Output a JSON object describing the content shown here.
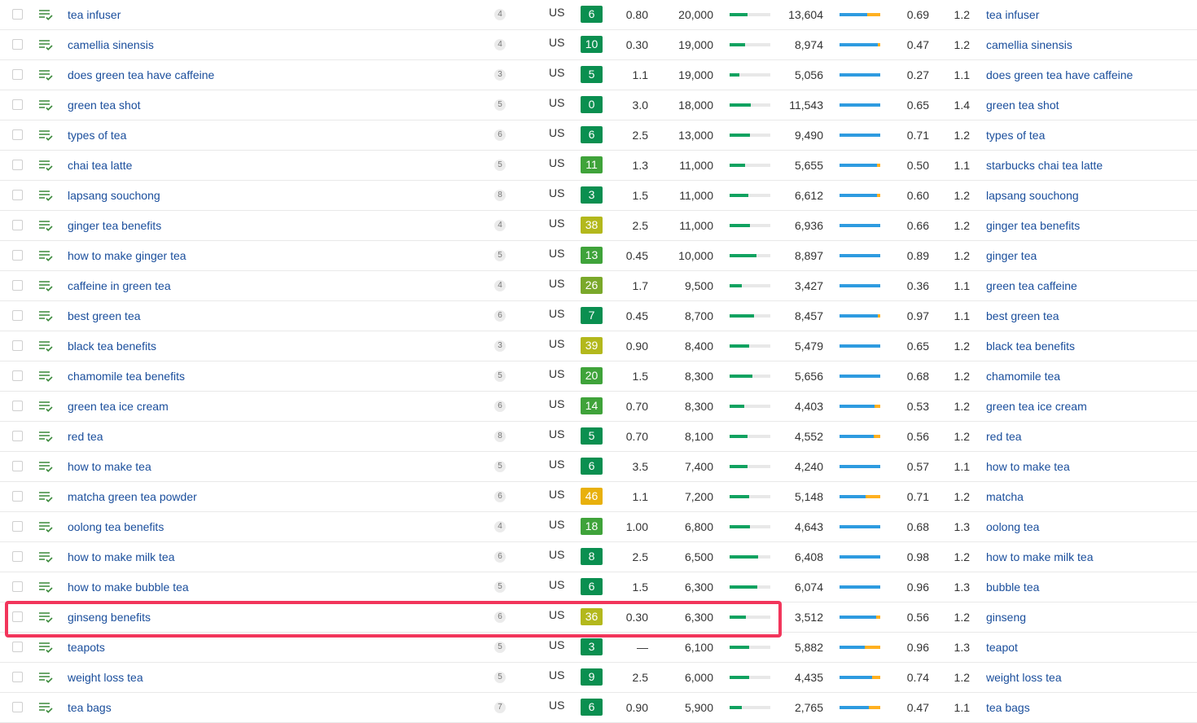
{
  "colors": {
    "link": "#1a4e9c",
    "highlight_border": "#f2355b",
    "kd_dark_green": "#0a8f50",
    "kd_green": "#3fa33a",
    "kd_lime": "#b3b81c",
    "kd_yellow": "#e8b00c",
    "volume_bar": "#10a260",
    "clicks_bar_blue": "#2e9be0",
    "clicks_bar_orange": "#ffb020"
  },
  "icons": {
    "row_icon": "list-check-icon"
  },
  "highlighted_keyword": "ginseng benefits",
  "rows": [
    {
      "keyword": "tea infuser",
      "position": "4",
      "country": "US",
      "kd": "6",
      "kd_color": "#0a8f50",
      "cpc": "0.80",
      "volume": "20,000",
      "volume_fill": 0.44,
      "clicks": "13,604",
      "clicks_fill": 0.68,
      "ratio": "0.69",
      "rr": "1.2",
      "parent": "tea infuser"
    },
    {
      "keyword": "camellia sinensis",
      "position": "4",
      "country": "US",
      "kd": "10",
      "kd_color": "#0a8f50",
      "cpc": "0.30",
      "volume": "19,000",
      "volume_fill": 0.38,
      "clicks": "8,974",
      "clicks_fill": 0.94,
      "ratio": "0.47",
      "rr": "1.2",
      "parent": "camellia sinensis"
    },
    {
      "keyword": "does green tea have caffeine",
      "position": "3",
      "country": "US",
      "kd": "5",
      "kd_color": "#0a8f50",
      "cpc": "1.1",
      "volume": "19,000",
      "volume_fill": 0.24,
      "clicks": "5,056",
      "clicks_fill": 1.0,
      "ratio": "0.27",
      "rr": "1.1",
      "parent": "does green tea have caffeine"
    },
    {
      "keyword": "green tea shot",
      "position": "5",
      "country": "US",
      "kd": "0",
      "kd_color": "#0a8f50",
      "cpc": "3.0",
      "volume": "18,000",
      "volume_fill": 0.52,
      "clicks": "11,543",
      "clicks_fill": 1.0,
      "ratio": "0.65",
      "rr": "1.4",
      "parent": "green tea shot"
    },
    {
      "keyword": "types of tea",
      "position": "6",
      "country": "US",
      "kd": "6",
      "kd_color": "#0a8f50",
      "cpc": "2.5",
      "volume": "13,000",
      "volume_fill": 0.5,
      "clicks": "9,490",
      "clicks_fill": 1.0,
      "ratio": "0.71",
      "rr": "1.2",
      "parent": "types of tea"
    },
    {
      "keyword": "chai tea latte",
      "position": "5",
      "country": "US",
      "kd": "11",
      "kd_color": "#3fa33a",
      "cpc": "1.3",
      "volume": "11,000",
      "volume_fill": 0.38,
      "clicks": "5,655",
      "clicks_fill": 0.92,
      "ratio": "0.50",
      "rr": "1.1",
      "parent": "starbucks chai tea latte"
    },
    {
      "keyword": "lapsang souchong",
      "position": "8",
      "country": "US",
      "kd": "3",
      "kd_color": "#0a8f50",
      "cpc": "1.5",
      "volume": "11,000",
      "volume_fill": 0.46,
      "clicks": "6,612",
      "clicks_fill": 0.92,
      "ratio": "0.60",
      "rr": "1.2",
      "parent": "lapsang souchong"
    },
    {
      "keyword": "ginger tea benefits",
      "position": "4",
      "country": "US",
      "kd": "38",
      "kd_color": "#b3b81c",
      "cpc": "2.5",
      "volume": "11,000",
      "volume_fill": 0.5,
      "clicks": "6,936",
      "clicks_fill": 1.0,
      "ratio": "0.66",
      "rr": "1.2",
      "parent": "ginger tea benefits"
    },
    {
      "keyword": "how to make ginger tea",
      "position": "5",
      "country": "US",
      "kd": "13",
      "kd_color": "#3fa33a",
      "cpc": "0.45",
      "volume": "10,000",
      "volume_fill": 0.66,
      "clicks": "8,897",
      "clicks_fill": 1.0,
      "ratio": "0.89",
      "rr": "1.2",
      "parent": "ginger tea"
    },
    {
      "keyword": "caffeine in green tea",
      "position": "4",
      "country": "US",
      "kd": "26",
      "kd_color": "#7aa82a",
      "cpc": "1.7",
      "volume": "9,500",
      "volume_fill": 0.3,
      "clicks": "3,427",
      "clicks_fill": 1.0,
      "ratio": "0.36",
      "rr": "1.1",
      "parent": "green tea caffeine"
    },
    {
      "keyword": "best green tea",
      "position": "6",
      "country": "US",
      "kd": "7",
      "kd_color": "#0a8f50",
      "cpc": "0.45",
      "volume": "8,700",
      "volume_fill": 0.6,
      "clicks": "8,457",
      "clicks_fill": 0.94,
      "ratio": "0.97",
      "rr": "1.1",
      "parent": "best green tea"
    },
    {
      "keyword": "black tea benefits",
      "position": "3",
      "country": "US",
      "kd": "39",
      "kd_color": "#b3b81c",
      "cpc": "0.90",
      "volume": "8,400",
      "volume_fill": 0.48,
      "clicks": "5,479",
      "clicks_fill": 1.0,
      "ratio": "0.65",
      "rr": "1.2",
      "parent": "black tea benefits"
    },
    {
      "keyword": "chamomile tea benefits",
      "position": "5",
      "country": "US",
      "kd": "20",
      "kd_color": "#3fa33a",
      "cpc": "1.5",
      "volume": "8,300",
      "volume_fill": 0.56,
      "clicks": "5,656",
      "clicks_fill": 1.0,
      "ratio": "0.68",
      "rr": "1.2",
      "parent": "chamomile tea"
    },
    {
      "keyword": "green tea ice cream",
      "position": "6",
      "country": "US",
      "kd": "14",
      "kd_color": "#3fa33a",
      "cpc": "0.70",
      "volume": "8,300",
      "volume_fill": 0.36,
      "clicks": "4,403",
      "clicks_fill": 0.86,
      "ratio": "0.53",
      "rr": "1.2",
      "parent": "green tea ice cream"
    },
    {
      "keyword": "red tea",
      "position": "8",
      "country": "US",
      "kd": "5",
      "kd_color": "#0a8f50",
      "cpc": "0.70",
      "volume": "8,100",
      "volume_fill": 0.44,
      "clicks": "4,552",
      "clicks_fill": 0.84,
      "ratio": "0.56",
      "rr": "1.2",
      "parent": "red tea"
    },
    {
      "keyword": "how to make tea",
      "position": "5",
      "country": "US",
      "kd": "6",
      "kd_color": "#0a8f50",
      "cpc": "3.5",
      "volume": "7,400",
      "volume_fill": 0.44,
      "clicks": "4,240",
      "clicks_fill": 1.0,
      "ratio": "0.57",
      "rr": "1.1",
      "parent": "how to make tea"
    },
    {
      "keyword": "matcha green tea powder",
      "position": "6",
      "country": "US",
      "kd": "46",
      "kd_color": "#e8b00c",
      "cpc": "1.1",
      "volume": "7,200",
      "volume_fill": 0.48,
      "clicks": "5,148",
      "clicks_fill": 0.64,
      "ratio": "0.71",
      "rr": "1.2",
      "parent": "matcha"
    },
    {
      "keyword": "oolong tea benefits",
      "position": "4",
      "country": "US",
      "kd": "18",
      "kd_color": "#3fa33a",
      "cpc": "1.00",
      "volume": "6,800",
      "volume_fill": 0.5,
      "clicks": "4,643",
      "clicks_fill": 1.0,
      "ratio": "0.68",
      "rr": "1.3",
      "parent": "oolong tea"
    },
    {
      "keyword": "how to make milk tea",
      "position": "6",
      "country": "US",
      "kd": "8",
      "kd_color": "#0a8f50",
      "cpc": "2.5",
      "volume": "6,500",
      "volume_fill": 0.7,
      "clicks": "6,408",
      "clicks_fill": 1.0,
      "ratio": "0.98",
      "rr": "1.2",
      "parent": "how to make milk tea"
    },
    {
      "keyword": "how to make bubble tea",
      "position": "5",
      "country": "US",
      "kd": "6",
      "kd_color": "#0a8f50",
      "cpc": "1.5",
      "volume": "6,300",
      "volume_fill": 0.68,
      "clicks": "6,074",
      "clicks_fill": 1.0,
      "ratio": "0.96",
      "rr": "1.3",
      "parent": "bubble tea"
    },
    {
      "keyword": "ginseng benefits",
      "position": "6",
      "country": "US",
      "kd": "36",
      "kd_color": "#b3b81c",
      "cpc": "0.30",
      "volume": "6,300",
      "volume_fill": 0.4,
      "clicks": "3,512",
      "clicks_fill": 0.9,
      "ratio": "0.56",
      "rr": "1.2",
      "parent": "ginseng"
    },
    {
      "keyword": "teapots",
      "position": "5",
      "country": "US",
      "kd": "3",
      "kd_color": "#0a8f50",
      "cpc": "—",
      "volume": "6,100",
      "volume_fill": 0.48,
      "clicks": "5,882",
      "clicks_fill": 0.62,
      "ratio": "0.96",
      "rr": "1.3",
      "parent": "teapot"
    },
    {
      "keyword": "weight loss tea",
      "position": "5",
      "country": "US",
      "kd": "9",
      "kd_color": "#0a8f50",
      "cpc": "2.5",
      "volume": "6,000",
      "volume_fill": 0.48,
      "clicks": "4,435",
      "clicks_fill": 0.8,
      "ratio": "0.74",
      "rr": "1.2",
      "parent": "weight loss tea"
    },
    {
      "keyword": "tea bags",
      "position": "7",
      "country": "US",
      "kd": "6",
      "kd_color": "#0a8f50",
      "cpc": "0.90",
      "volume": "5,900",
      "volume_fill": 0.3,
      "clicks": "2,765",
      "clicks_fill": 0.72,
      "ratio": "0.47",
      "rr": "1.1",
      "parent": "tea bags"
    }
  ]
}
